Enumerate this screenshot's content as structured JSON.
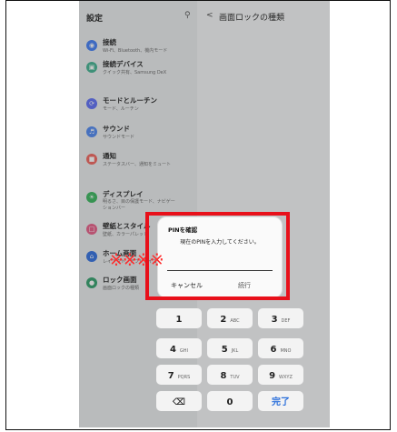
{
  "settings": {
    "header": "設定",
    "items": [
      {
        "title": "接続",
        "subtitle": "Wi-Fi、Bluetooth、機内モード",
        "icon": "wifi-icon",
        "color": "#3f7cf4"
      },
      {
        "title": "接続デバイス",
        "subtitle": "クイック共有、Samsung DeX",
        "icon": "devices-icon",
        "color": "#3fb18f"
      },
      {
        "title": "モードとルーチン",
        "subtitle": "モード、ルーチン",
        "icon": "routine-icon",
        "color": "#5a6df5"
      },
      {
        "title": "サウンド",
        "subtitle": "サウンドモード",
        "icon": "sound-icon",
        "color": "#4c86f0"
      },
      {
        "title": "通知",
        "subtitle": "ステータスバー、通知をミュート",
        "icon": "notification-icon",
        "color": "#f0625a"
      },
      {
        "title": "ディスプレイ",
        "subtitle": "明るさ、目の保護モード、ナビゲーションバー",
        "icon": "display-icon",
        "color": "#35b55a"
      },
      {
        "title": "壁紙とスタイル",
        "subtitle": "壁紙、カラーパレット",
        "icon": "wallpaper-icon",
        "color": "#e65a86"
      },
      {
        "title": "ホーム画面",
        "subtitle": "レイアウト、アプリアイコン",
        "icon": "home-icon",
        "color": "#2f6ee0"
      },
      {
        "title": "ロック画面",
        "subtitle": "画面ロックの種類",
        "icon": "lock-icon",
        "color": "#2f9f6a"
      }
    ]
  },
  "right_pane": {
    "back": "<",
    "title": "画面ロックの種類"
  },
  "dialog": {
    "title": "PINを確認",
    "prompt": "現在のPINを入力してください。",
    "masked": "※※※※",
    "cancel": "キャンセル",
    "next": "続行"
  },
  "keypad": {
    "keys": [
      {
        "n": "1",
        "l": ""
      },
      {
        "n": "2",
        "l": "ABC"
      },
      {
        "n": "3",
        "l": "DEF"
      },
      {
        "n": "4",
        "l": "GHI"
      },
      {
        "n": "5",
        "l": "JKL"
      },
      {
        "n": "6",
        "l": "MNO"
      },
      {
        "n": "7",
        "l": "PQRS"
      },
      {
        "n": "8",
        "l": "TUV"
      },
      {
        "n": "9",
        "l": "WXYZ"
      },
      {
        "n": "⌫",
        "l": ""
      },
      {
        "n": "0",
        "l": ""
      },
      {
        "n": "完了",
        "l": ""
      }
    ]
  },
  "colors": {
    "highlight": "#e8101a",
    "mask": "#ff2b2b",
    "done": "#2a6fdb"
  }
}
